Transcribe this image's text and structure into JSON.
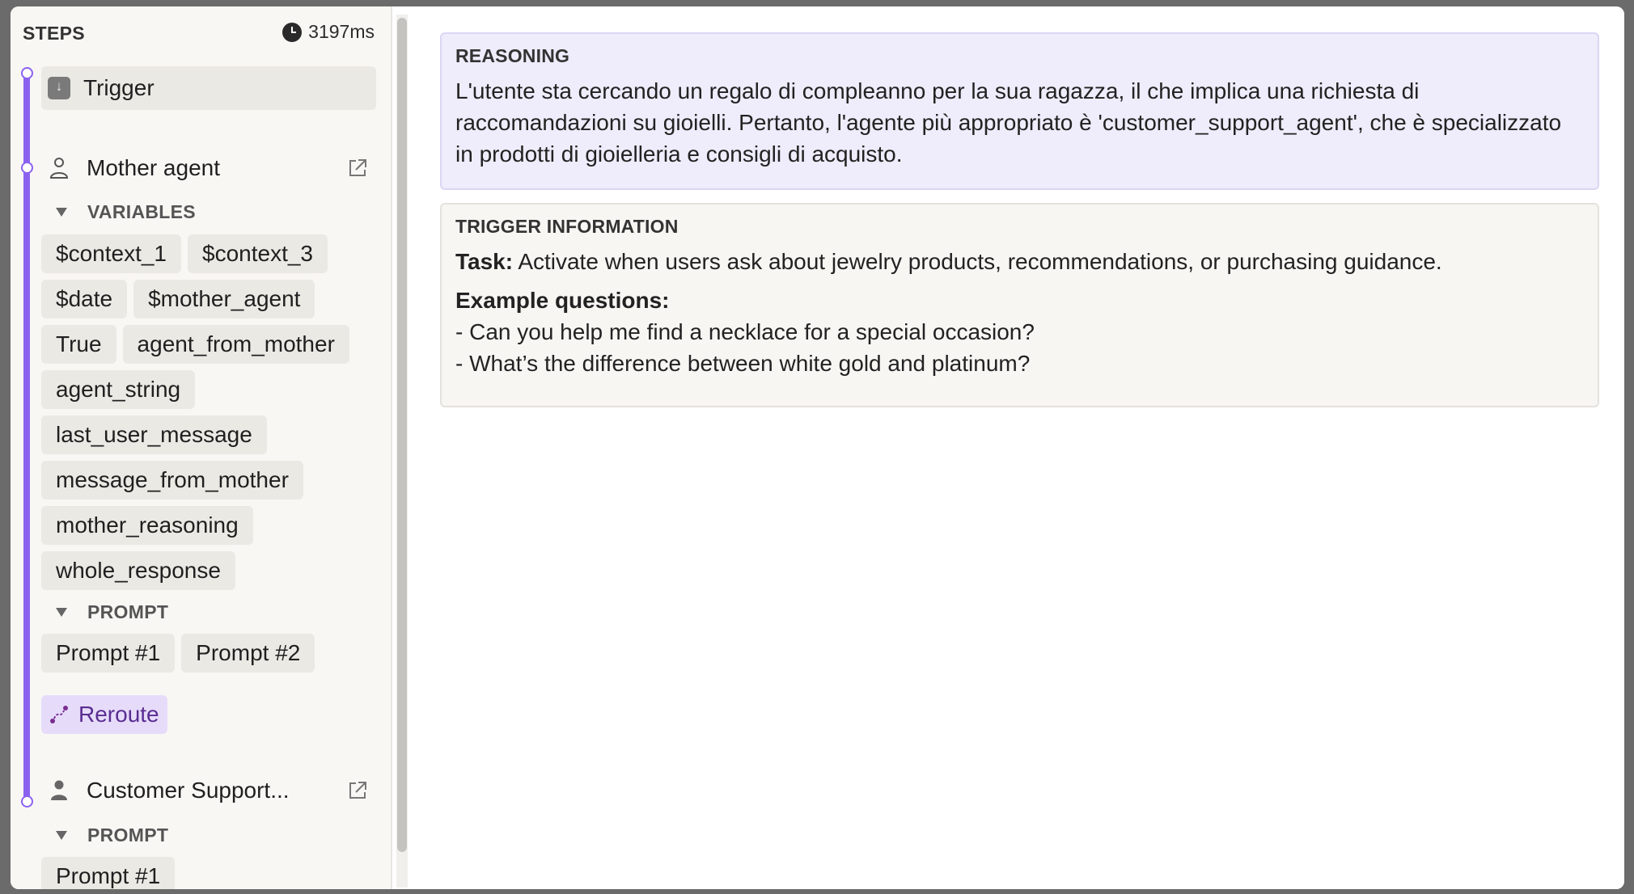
{
  "sidebar": {
    "title": "STEPS",
    "timer": "3197ms",
    "trigger_label": "Trigger",
    "mother_agent": {
      "name": "Mother agent",
      "variables_header": "VARIABLES",
      "variables": [
        "$context_1",
        "$context_3",
        "$date",
        "$mother_agent",
        "True",
        "agent_from_mother",
        "agent_string",
        "last_user_message",
        "message_from_mother",
        "mother_reasoning",
        "whole_response"
      ],
      "prompt_header": "PROMPT",
      "prompts": [
        "Prompt #1",
        "Prompt #2"
      ]
    },
    "reroute_label": "Reroute",
    "customer_support": {
      "name": "Customer Support...",
      "prompt_header": "PROMPT",
      "prompts": [
        "Prompt #1"
      ]
    }
  },
  "main": {
    "reasoning": {
      "title": "REASONING",
      "text": "L'utente sta cercando un regalo di compleanno per la sua ragazza, il che implica una richiesta di raccomandazioni su gioielli. Pertanto, l'agente più appropriato è 'customer_support_agent', che è specializzato in prodotti di gioielleria e consigli di acquisto."
    },
    "trigger_info": {
      "title": "TRIGGER INFORMATION",
      "task_label": "Task:",
      "task_text": "Activate when users ask about jewelry products, recommendations, or purchasing guidance.",
      "examples_label": "Example questions:",
      "examples": [
        "- Can you help me find a necklace for a special occasion?",
        "- What’s the difference between white gold and platinum?"
      ]
    }
  },
  "colors": {
    "timeline": "#8b62f0",
    "reasoning_bg": "#efecfb",
    "reroute_bg": "#e6dcfa",
    "reroute_text": "#5a2d91"
  }
}
